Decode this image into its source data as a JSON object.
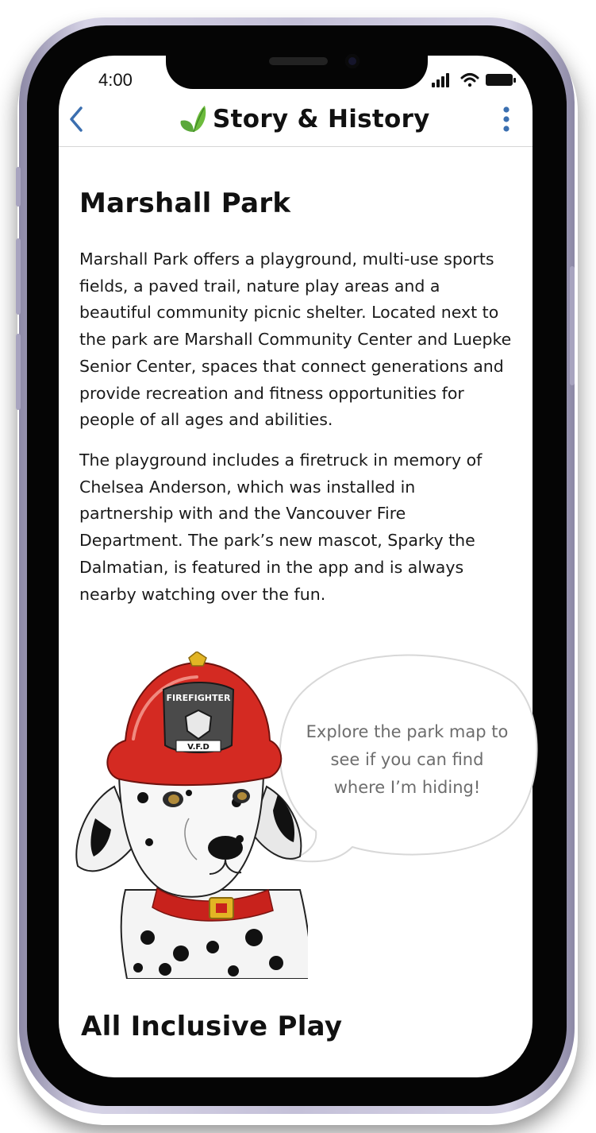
{
  "status_bar": {
    "time": "4:00"
  },
  "nav": {
    "title": "Story & History",
    "back_icon": "chevron-left-icon",
    "logo_icon": "leaf-icon",
    "more_icon": "more-vertical-icon",
    "accent_color": "#3b6fb0",
    "leaf_color": "#5aa83a"
  },
  "section1": {
    "heading": "Marshall Park",
    "paragraph1": "Marshall  Park offers a playground, multi-use sports fields, a paved trail, nature play areas and a beautiful community picnic shelter.  Located next to the park are  Marshall Community Center and  Luepke Senior Center, spaces that connect generations and provide recreation and fitness opportunities for people of all ages and abilities.",
    "paragraph2": "The playground includes a firetruck in memory of Chelsea Anderson, which was installed in partnership with and the Vancouver  Fire Department. The park’s new mascot, Sparky the Dalmatian, is featured in the app and is always nearby watching over the fun."
  },
  "mascot": {
    "speech_bubble": "Explore the park map to see if you can find where  I’m hiding!",
    "helmet_text": "FIREFIGHTER",
    "badge_text": "V.F.D"
  },
  "section2": {
    "heading": "All Inclusive Play"
  }
}
